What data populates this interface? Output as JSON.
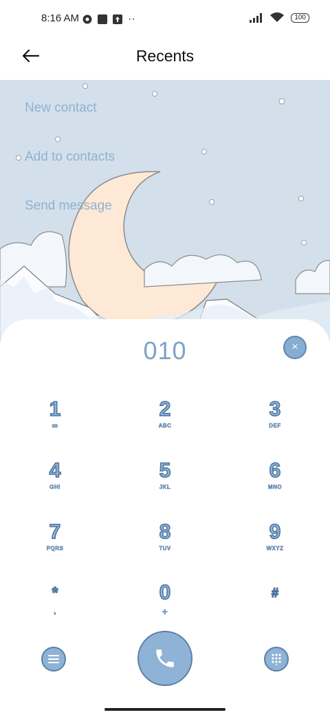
{
  "status_bar": {
    "time": "8:16 AM",
    "dots": "··",
    "battery": "100"
  },
  "header": {
    "title": "Recents",
    "back_icon": "arrow-left-icon"
  },
  "actions": [
    {
      "label": "New contact"
    },
    {
      "label": "Add to contacts"
    },
    {
      "label": "Send message"
    }
  ],
  "dialer": {
    "number": "010",
    "clear_icon": "×",
    "keys": [
      {
        "digit": "1",
        "letters": "ꝏ"
      },
      {
        "digit": "2",
        "letters": "ABC"
      },
      {
        "digit": "3",
        "letters": "DEF"
      },
      {
        "digit": "4",
        "letters": "GHI"
      },
      {
        "digit": "5",
        "letters": "JKL"
      },
      {
        "digit": "6",
        "letters": "MNO"
      },
      {
        "digit": "7",
        "letters": "PQRS"
      },
      {
        "digit": "8",
        "letters": "TUV"
      },
      {
        "digit": "9",
        "letters": "WXYZ"
      },
      {
        "digit": "*",
        "letters": ","
      },
      {
        "digit": "0",
        "letters": "+"
      },
      {
        "digit": "#",
        "letters": ""
      }
    ]
  },
  "colors": {
    "accent": "#8fb3d6",
    "accent_dark": "#5a7fa6",
    "hero_bg": "#d3e0ec",
    "moon": "#fde9d6"
  }
}
